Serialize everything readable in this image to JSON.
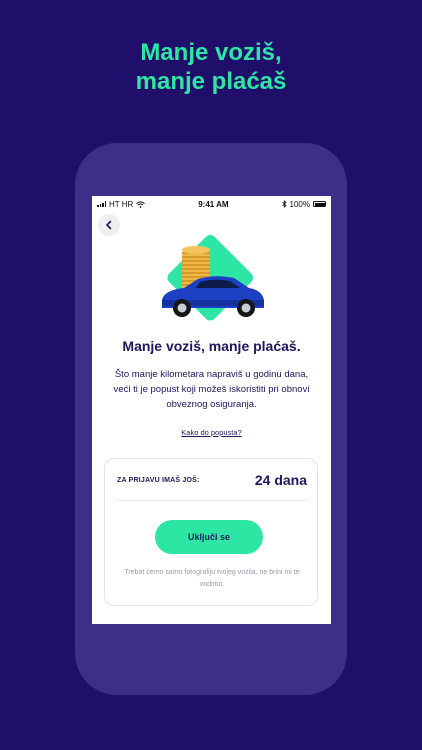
{
  "promo": {
    "line1": "Manje voziš,",
    "line2": "manje plaćaš"
  },
  "status_bar": {
    "carrier": "HT HR",
    "time": "9:41 AM",
    "battery": "100%"
  },
  "screen": {
    "title": "Manje voziš, manje plaćaš.",
    "description": "Što manje kilometara napraviš u godinu dana, veći ti je popust koji možeš iskoristiti pri obnovi obveznog osiguranja.",
    "link": "Kako do popusta?",
    "card": {
      "label": "ZA PRIJAVU IMAŠ JOŠ:",
      "value": "24 dana",
      "button": "Uključi se",
      "note": "Trebat ćemo samo fotografiju tvojeg vozila, ne brini mi te vodimo."
    }
  },
  "colors": {
    "background": "#1f0f6b",
    "accent": "#2ee6a3",
    "text": "#1f1660",
    "car": "#1c3fc4"
  },
  "icons": [
    "signal-icon",
    "wifi-icon",
    "bluetooth-icon",
    "battery-icon",
    "back-arrow-icon"
  ]
}
